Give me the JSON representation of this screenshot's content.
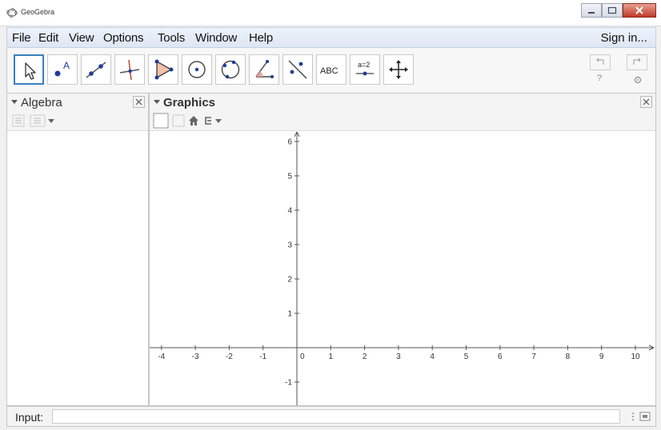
{
  "window": {
    "title": "GeoGebra"
  },
  "menu": {
    "items": [
      "File",
      "Edit",
      "View",
      "Options",
      "Tools",
      "Window",
      "Help"
    ],
    "sign_in": "Sign in..."
  },
  "toolbar": {
    "tools": [
      "move-icon",
      "point-icon",
      "line-icon",
      "perpendicular-icon",
      "polygon-icon",
      "circle-icon",
      "circle-three-points-icon",
      "angle-icon",
      "reflect-icon",
      "text-icon",
      "slider-icon",
      "move-graphics-icon"
    ],
    "text_tool_label": "ABC",
    "slider_tool_label": "a=2",
    "help_mark": "?"
  },
  "algebra": {
    "title": "Algebra"
  },
  "graphics": {
    "title": "Graphics",
    "x_ticks": [
      "-4",
      "-3",
      "-2",
      "-1",
      "0",
      "1",
      "2",
      "3",
      "4",
      "5",
      "6",
      "7",
      "8",
      "9",
      "10"
    ],
    "y_ticks": [
      "6",
      "5",
      "4",
      "3",
      "2",
      "1",
      "0",
      "-1"
    ]
  },
  "input": {
    "label": "Input:",
    "value": ""
  },
  "colors": {
    "accent": "#3a7fc1",
    "menubar": "#dde6f4",
    "close_button": "#c0392b"
  }
}
